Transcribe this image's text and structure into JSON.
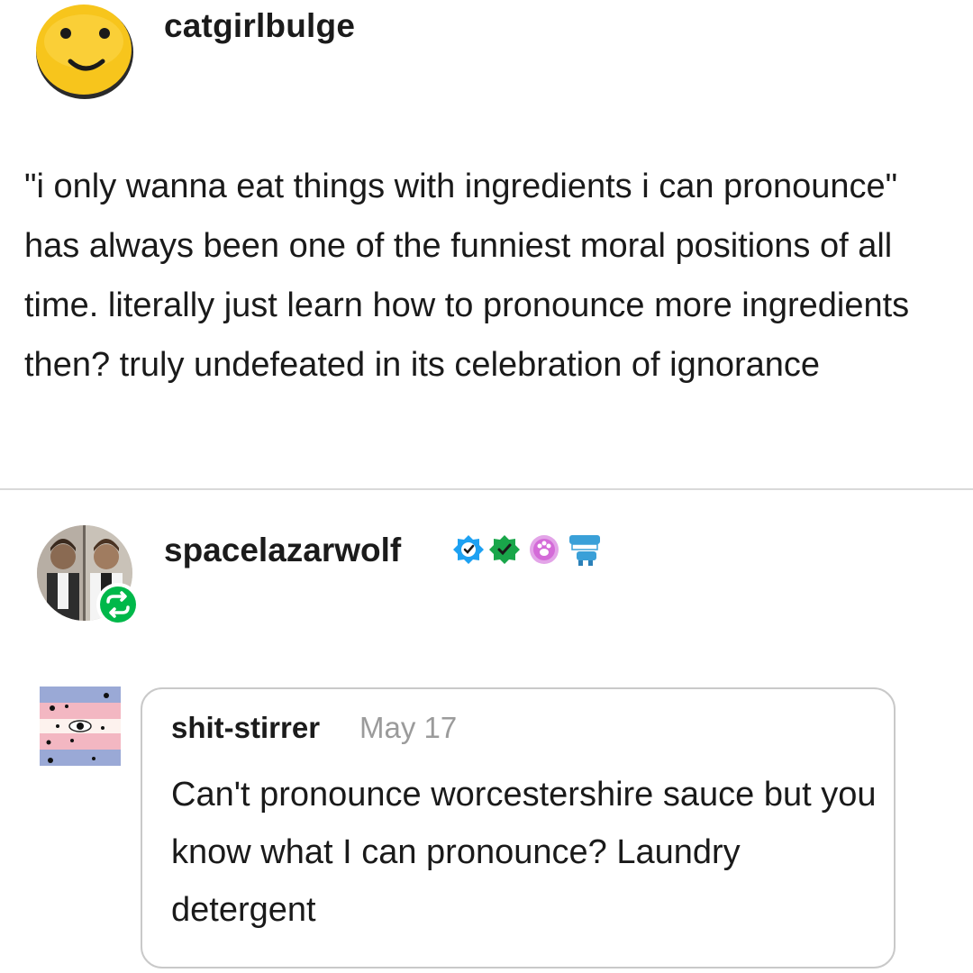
{
  "post": {
    "author": "catgirlbulge",
    "avatar_icon": "smiley-face-icon",
    "text": "\"i only wanna eat things with ingredients i can pronounce\" has always been one of the funniest moral positions of all time. literally just learn how to pronounce more ingredients then? truly undefeated in its celebration of ignorance"
  },
  "reblog": {
    "author": "spacelazarwolf",
    "badges": [
      "verified-blue-icon",
      "verified-green-icon",
      "paw-badge-icon",
      "chattering-teeth-icon"
    ],
    "reblog_icon": "reblog-icon",
    "ask": {
      "asker": "shit-stirrer",
      "date": "May 17",
      "text": "Can't pronounce worcestershire sauce but you know what I can pronounce? Laundry detergent"
    }
  },
  "colors": {
    "smiley": "#f5c518",
    "reblog_green": "#00b84a",
    "badge_blue": "#1da1f2",
    "badge_green": "#19a64a",
    "badge_pink": "#d46bd8",
    "date_gray": "#9b9b9b",
    "border": "#c9c9c9"
  }
}
